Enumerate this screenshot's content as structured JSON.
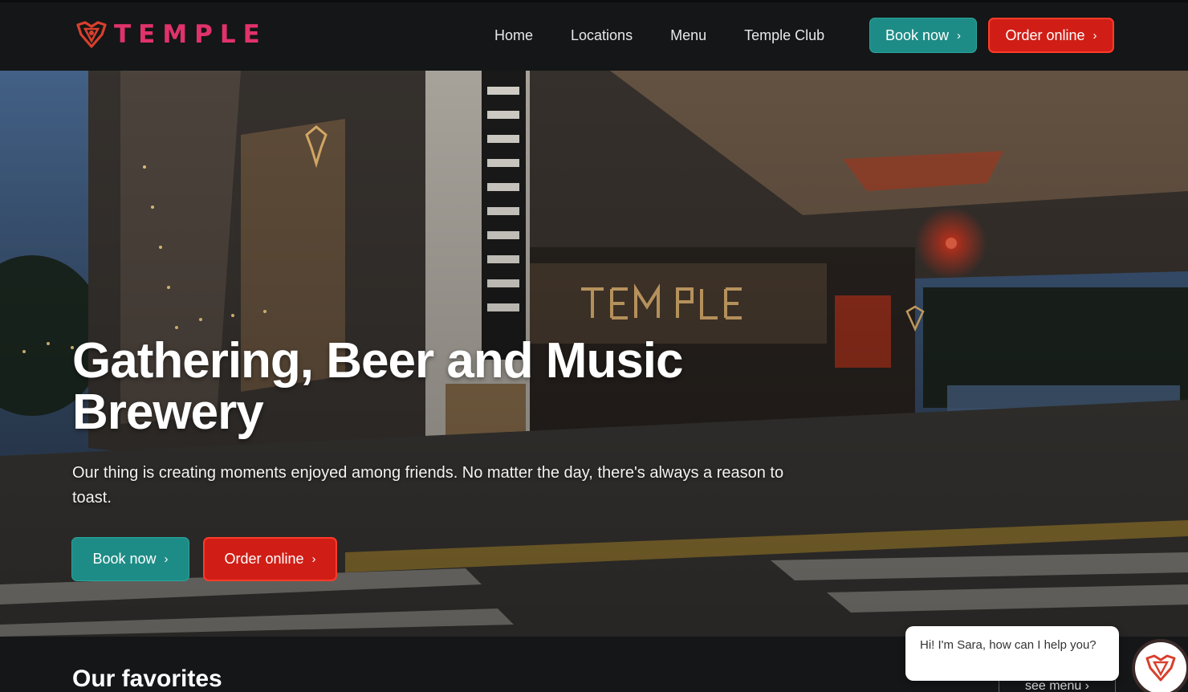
{
  "brand": {
    "name": "TEMPLE"
  },
  "nav": {
    "links": [
      "Home",
      "Locations",
      "Menu",
      "Temple Club"
    ],
    "book_label": "Book now",
    "order_label": "Order online"
  },
  "hero": {
    "title_line1": "Gathering, Beer and Music",
    "title_line2": "Brewery",
    "subtitle": "Our thing is creating moments enjoyed among friends. No matter the day, there's always a reason to toast.",
    "book_label": "Book now",
    "order_label": "Order online"
  },
  "favorites": {
    "title": "Our favorites",
    "see_menu_label": "see menu"
  },
  "chat": {
    "message": "Hi! I'm Sara, how can I help you?"
  },
  "colors": {
    "brand_pink": "#e0326b",
    "teal": "#1e8c86",
    "red": "#d01e16",
    "nav_bg": "#141617"
  },
  "icons": {
    "chevron": "chevron-right-icon",
    "logo": "temple-logo-icon"
  }
}
